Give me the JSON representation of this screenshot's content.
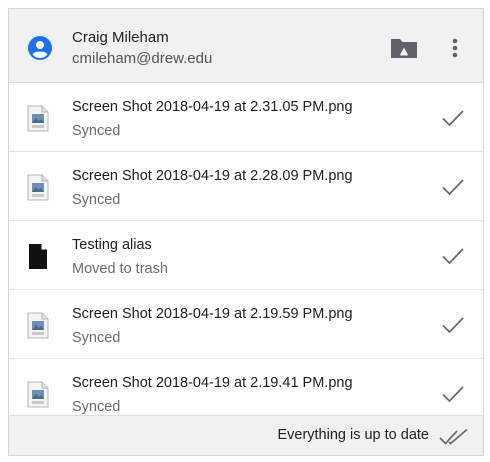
{
  "account": {
    "name": "Craig Mileham",
    "email": "cmileham@drew.edu"
  },
  "files": [
    {
      "name": "Screen Shot 2018-04-19 at 2.31.05 PM.png",
      "status": "Synced",
      "icon": "png-file-icon"
    },
    {
      "name": "Screen Shot 2018-04-19 at 2.28.09 PM.png",
      "status": "Synced",
      "icon": "png-file-icon"
    },
    {
      "name": "Testing alias",
      "status": "Moved to trash",
      "icon": "document-icon"
    },
    {
      "name": "Screen Shot 2018-04-19 at 2.19.59 PM.png",
      "status": "Synced",
      "icon": "png-file-icon"
    },
    {
      "name": "Screen Shot 2018-04-19 at 2.19.41 PM.png",
      "status": "Synced",
      "icon": "png-file-icon"
    }
  ],
  "footer": {
    "status": "Everything is up to date"
  },
  "colors": {
    "accent": "#1a73e8",
    "header_bg": "#f1f1f1",
    "icon_gray": "#5f6368"
  }
}
